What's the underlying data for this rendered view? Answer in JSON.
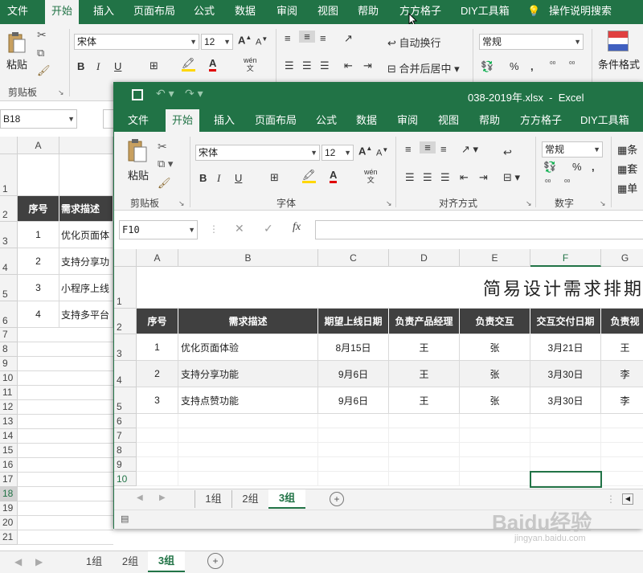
{
  "bg": {
    "tabs": [
      "文件",
      "开始",
      "插入",
      "页面布局",
      "公式",
      "数据",
      "审阅",
      "视图",
      "帮助",
      "方方格子",
      "DIY工具箱"
    ],
    "tell_me": "操作说明搜索",
    "font_name": "宋体",
    "font_size": "12",
    "number_format": "常规",
    "wrap_text": "自动换行",
    "merge_center": "合并后居中",
    "cond_format": "条件格式",
    "paste_label": "粘贴",
    "clipboard_group": "剪贴板",
    "name_box": "B18",
    "col_a": "A",
    "header_seq": "序号",
    "header_desc": "需求描述",
    "rows": [
      {
        "num": "1",
        "seq": "",
        "desc": ""
      },
      {
        "num": "2",
        "seq": "序号",
        "desc": "需求描述"
      },
      {
        "num": "3",
        "seq": "1",
        "desc": "优化页面体"
      },
      {
        "num": "4",
        "seq": "2",
        "desc": "支持分享功"
      },
      {
        "num": "5",
        "seq": "3",
        "desc": "小程序上线"
      },
      {
        "num": "6",
        "seq": "4",
        "desc": "支持多平台"
      }
    ],
    "empty_rows": [
      "7",
      "8",
      "9",
      "10",
      "11",
      "12",
      "13",
      "14",
      "15",
      "16",
      "17",
      "18",
      "19",
      "20",
      "21"
    ],
    "sheets": [
      "1组",
      "2组",
      "3组"
    ],
    "active_sheet": "3组",
    "font_ab": "wén",
    "font_ab2": "文"
  },
  "win": {
    "title": "038-2019年.xlsx  -  Excel",
    "tabs": [
      "文件",
      "开始",
      "插入",
      "页面布局",
      "公式",
      "数据",
      "审阅",
      "视图",
      "帮助",
      "方方格子",
      "DIY工具箱"
    ],
    "font_name": "宋体",
    "font_size": "12",
    "number_format": "常规",
    "paste_label": "粘贴",
    "groups": {
      "clipboard": "剪贴板",
      "font": "字体",
      "align": "对齐方式",
      "number": "数字"
    },
    "side_labels": [
      "条",
      "套",
      "单"
    ],
    "name_box": "F10",
    "fx": "fx",
    "columns": [
      "A",
      "B",
      "C",
      "D",
      "E",
      "F",
      "G"
    ],
    "title_text": "简易设计需求排期",
    "headers": [
      "序号",
      "需求描述",
      "期望上线日期",
      "负责产品经理",
      "负责交互",
      "交互交付日期",
      "负责视"
    ],
    "rows": [
      [
        "1",
        "优化页面体验",
        "8月15日",
        "王",
        "张",
        "3月21日",
        "王"
      ],
      [
        "2",
        "支持分享功能",
        "9月6日",
        "王",
        "张",
        "3月30日",
        "李"
      ],
      [
        "3",
        "支持点赞功能",
        "9月6日",
        "王",
        "张",
        "3月30日",
        "李"
      ]
    ],
    "row_nums": [
      "1",
      "2",
      "3",
      "4",
      "5",
      "6",
      "7",
      "8",
      "9",
      "10"
    ],
    "sheets": [
      "1组",
      "2组",
      "3组"
    ],
    "active_sheet": "3组",
    "percent": "%",
    "comma": ","
  },
  "watermark": {
    "brand": "Baidu经验",
    "url": "jingyan.baidu.com"
  }
}
